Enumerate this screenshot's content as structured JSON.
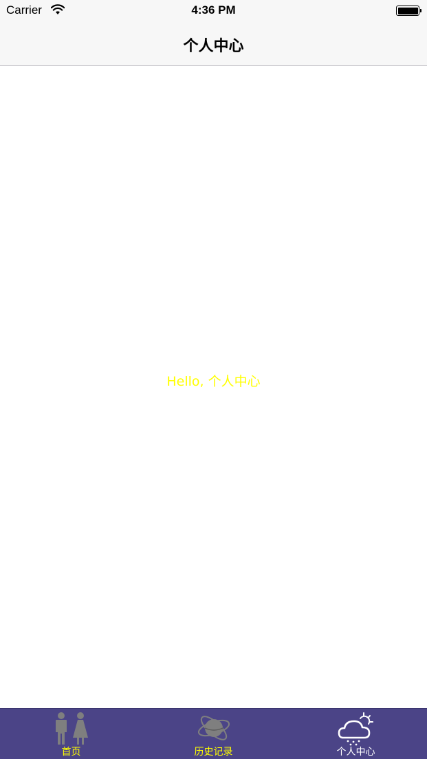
{
  "status_bar": {
    "carrier": "Carrier",
    "time": "4:36 PM"
  },
  "nav": {
    "title": "个人中心"
  },
  "content": {
    "greeting": "Hello, 个人中心"
  },
  "tab_bar": {
    "background": "#4b4487",
    "tabs": [
      {
        "label": "首页",
        "icon": "people-icon",
        "selected": false
      },
      {
        "label": "历史记录",
        "icon": "planet-icon",
        "selected": false
      },
      {
        "label": "个人中心",
        "icon": "weather-cloud-icon",
        "selected": true
      }
    ]
  },
  "colors": {
    "greeting": "#ffff00",
    "tab_label_inactive": "#ffff00",
    "tab_label_active": "#ffffff",
    "tab_icon_inactive": "#7f7f7f"
  }
}
